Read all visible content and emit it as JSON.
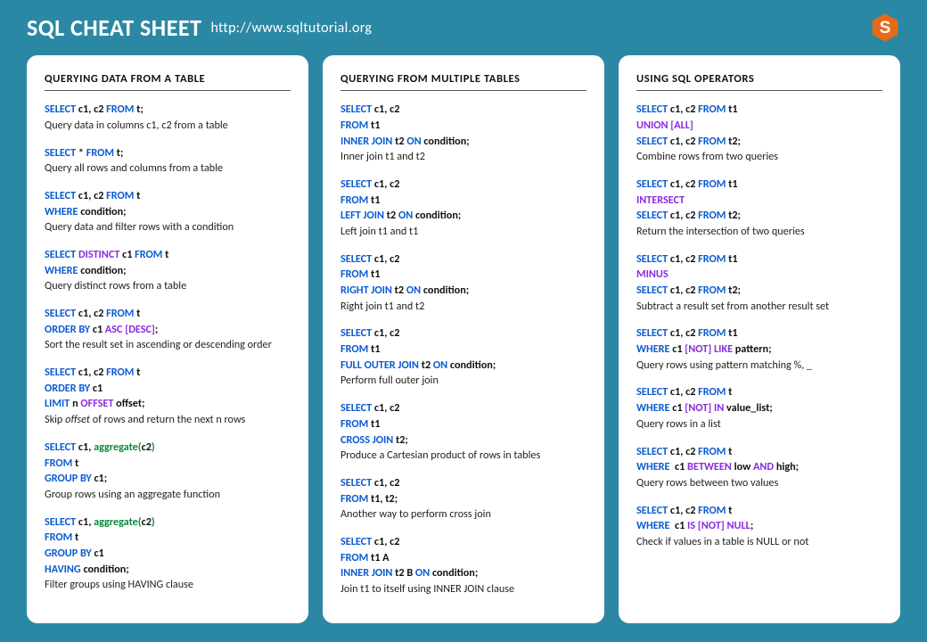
{
  "header": {
    "title": "SQL CHEAT SHEET",
    "url": "http://www.sqltutorial.org"
  },
  "columns": [
    {
      "heading": "QUERYING  DATA  FROM  A TABLE",
      "blocks": [
        {
          "code": "<span class='kw'>SELECT</span> c1, c2 <span class='kw'>FROM</span> t;",
          "desc": "Query data in columns c1, c2 from a table"
        },
        {
          "code": "<span class='kw'>SELECT</span> * <span class='kw'>FROM</span> t;",
          "desc": "Query all rows and columns  from a table"
        },
        {
          "code": "<span class='kw'>SELECT</span> c1, c2 <span class='kw'>FROM</span> t<br><span class='kw'>WHERE</span> condition;",
          "desc": "Query data and filter rows with  a condition"
        },
        {
          "code": "<span class='kw'>SELECT</span> <span class='alt'>DISTINCT</span> c1 <span class='kw'>FROM</span> t<br><span class='kw'>WHERE</span> condition;",
          "desc": "Query distinct rows from a table"
        },
        {
          "code": "<span class='kw'>SELECT</span> c1, c2 <span class='kw'>FROM</span> t<br><span class='kw'>ORDER BY</span> c1 <span class='alt'>ASC [DESC]</span>;",
          "desc": "Sort the result set in ascending or descending order"
        },
        {
          "code": "<span class='kw'>SELECT</span> c1, c2 <span class='kw'>FROM</span> t<br><span class='kw'>ORDER BY</span> c1<br><span class='kw'>LIMIT</span> n <span class='alt'>OFFSET</span> offset;",
          "desc": "Skip <span class='italic'>offset</span> of rows and return the next n rows"
        },
        {
          "code": "<span class='kw'>SELECT</span> c1, <span class='fn'>aggregate(</span>c2<span class='fn'>)</span><br><span class='kw'>FROM</span> t<br><span class='kw'>GROUP BY</span> c1;",
          "desc": "Group rows using an aggregate function"
        },
        {
          "code": "<span class='kw'>SELECT</span> c1, <span class='fn'>aggregate(</span>c2<span class='fn'>)</span><br><span class='kw'>FROM</span> t<br><span class='kw'>GROUP BY</span> c1<br><span class='kw'>HAVING</span> condition;",
          "desc": "Filter groups using HAVING clause"
        }
      ]
    },
    {
      "heading": "QUERYING  FROM  MULTIPLE  TABLES",
      "blocks": [
        {
          "code": "<span class='kw'>SELECT</span> c1, c2<br><span class='kw'>FROM</span> t1<br><span class='kw'>INNER JOIN</span> t2 <span class='kw'>ON</span> condition;",
          "desc": "Inner join t1 and t2"
        },
        {
          "code": "<span class='kw'>SELECT</span> c1, c2<br><span class='kw'>FROM</span> t1<br><span class='kw'>LEFT JOIN</span> t2 <span class='kw'>ON</span> condition;",
          "desc": "Left join t1 and t1"
        },
        {
          "code": "<span class='kw'>SELECT</span> c1, c2<br><span class='kw'>FROM</span> t1<br><span class='kw'>RIGHT JOIN</span> t2 <span class='kw'>ON</span> condition;",
          "desc": "Right join t1 and t2"
        },
        {
          "code": "<span class='kw'>SELECT</span> c1, c2<br><span class='kw'>FROM</span> t1<br><span class='kw'>FULL OUTER JOIN</span> t2 <span class='kw'>ON</span> condition;",
          "desc": "Perform full outer join"
        },
        {
          "code": "<span class='kw'>SELECT</span> c1, c2<br><span class='kw'>FROM</span> t1<br><span class='kw'>CROSS JOIN</span> t2;",
          "desc": "Produce a Cartesian product of rows in tables"
        },
        {
          "code": "<span class='kw'>SELECT</span> c1, c2<br><span class='kw'>FROM</span> t1, t2;",
          "desc": "Another way to perform cross join"
        },
        {
          "code": "<span class='kw'>SELECT</span> c1, c2<br><span class='kw'>FROM</span> t1 A<br><span class='kw'>INNER JOIN</span> t2 B <span class='kw'>ON</span> condition;",
          "desc": "Join t1 to itself using INNER JOIN clause"
        }
      ]
    },
    {
      "heading": "USING  SQL OPERATORS",
      "blocks": [
        {
          "code": "<span class='kw'>SELECT</span> c1, c2 <span class='kw'>FROM</span> t1<br><span class='alt'>UNION  [ALL]</span><br><span class='kw'>SELECT</span> c1, c2 <span class='kw'>FROM</span> t2;",
          "desc": "Combine rows from two queries"
        },
        {
          "code": "<span class='kw'>SELECT</span> c1, c2 <span class='kw'>FROM</span> t1<br><span class='alt'>INTERSECT</span><br><span class='kw'>SELECT</span> c1, c2 <span class='kw'>FROM</span> t2;",
          "desc": "Return the intersection of two queries"
        },
        {
          "code": "<span class='kw'>SELECT</span> c1, c2 <span class='kw'>FROM</span> t1<br><span class='alt'>MINUS</span><br><span class='kw'>SELECT</span> c1, c2 <span class='kw'>FROM</span> t2;",
          "desc": "Subtract a result set from another result set"
        },
        {
          "code": "<span class='kw'>SELECT</span> c1, c2 <span class='kw'>FROM</span> t1<br><span class='kw'>WHERE</span> c1 <span class='alt'>[NOT] LIKE</span> pattern;",
          "desc": "Query rows using pattern matching %, _"
        },
        {
          "code": "<span class='kw'>SELECT</span> c1, c2 <span class='kw'>FROM</span> t<br><span class='kw'>WHERE</span> c1 <span class='alt'>[NOT] IN</span> value_list;",
          "desc": "Query rows in a list"
        },
        {
          "code": "<span class='kw'>SELECT</span> c1, c2 <span class='kw'>FROM</span> t<br><span class='kw'>WHERE</span>&nbsp;&nbsp;c1 <span class='alt'>BETWEEN</span> low <span class='alt'>AND</span> high;",
          "desc": "Query rows between two values"
        },
        {
          "code": "<span class='kw'>SELECT</span> c1, c2 <span class='kw'>FROM</span> t<br><span class='kw'>WHERE</span>&nbsp;&nbsp;c1 <span class='alt'>IS [NOT] NULL</span>;",
          "desc": "Check if values in a table is NULL or not"
        }
      ]
    }
  ]
}
